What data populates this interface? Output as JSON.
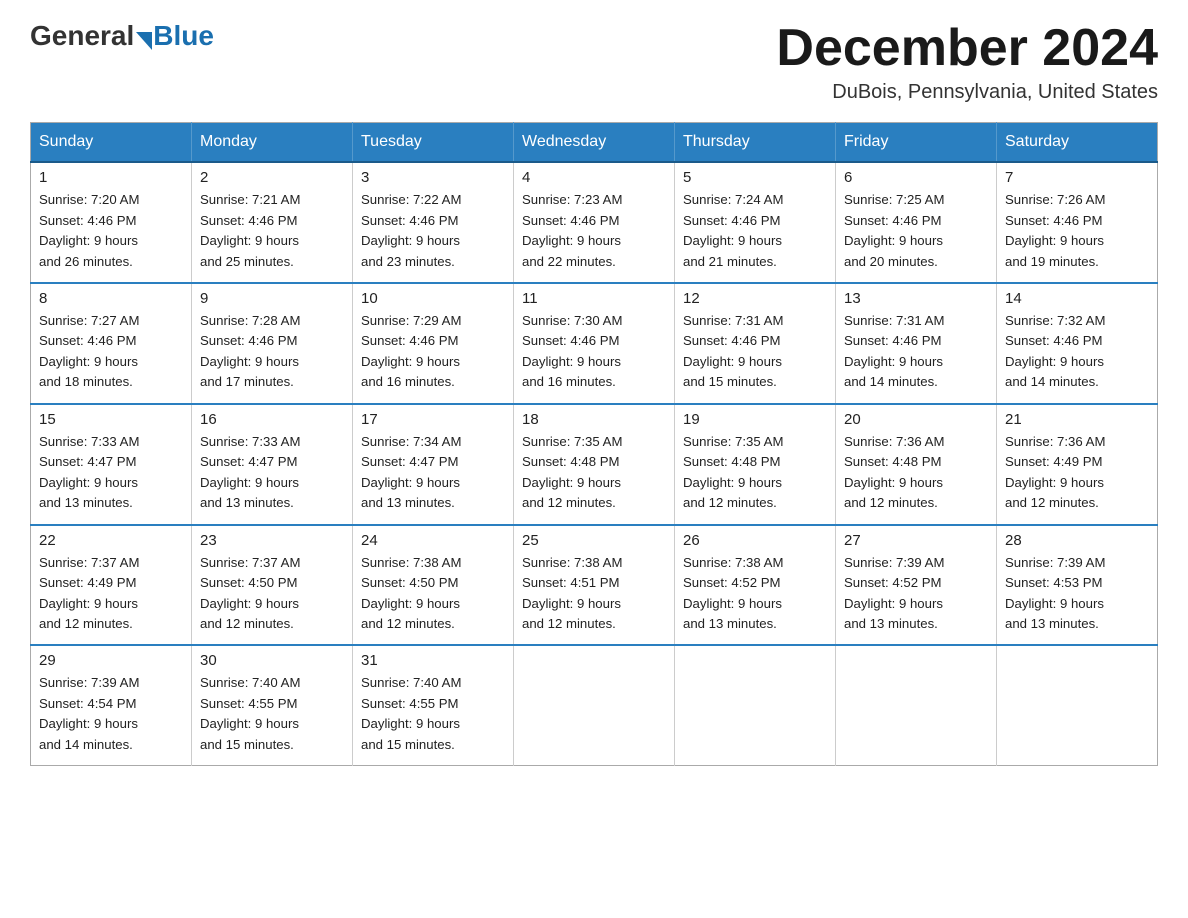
{
  "logo": {
    "general": "General",
    "blue": "Blue"
  },
  "title": "December 2024",
  "location": "DuBois, Pennsylvania, United States",
  "days_of_week": [
    "Sunday",
    "Monday",
    "Tuesday",
    "Wednesday",
    "Thursday",
    "Friday",
    "Saturday"
  ],
  "weeks": [
    [
      {
        "day": "1",
        "sunrise": "7:20 AM",
        "sunset": "4:46 PM",
        "daylight": "9 hours and 26 minutes."
      },
      {
        "day": "2",
        "sunrise": "7:21 AM",
        "sunset": "4:46 PM",
        "daylight": "9 hours and 25 minutes."
      },
      {
        "day": "3",
        "sunrise": "7:22 AM",
        "sunset": "4:46 PM",
        "daylight": "9 hours and 23 minutes."
      },
      {
        "day": "4",
        "sunrise": "7:23 AM",
        "sunset": "4:46 PM",
        "daylight": "9 hours and 22 minutes."
      },
      {
        "day": "5",
        "sunrise": "7:24 AM",
        "sunset": "4:46 PM",
        "daylight": "9 hours and 21 minutes."
      },
      {
        "day": "6",
        "sunrise": "7:25 AM",
        "sunset": "4:46 PM",
        "daylight": "9 hours and 20 minutes."
      },
      {
        "day": "7",
        "sunrise": "7:26 AM",
        "sunset": "4:46 PM",
        "daylight": "9 hours and 19 minutes."
      }
    ],
    [
      {
        "day": "8",
        "sunrise": "7:27 AM",
        "sunset": "4:46 PM",
        "daylight": "9 hours and 18 minutes."
      },
      {
        "day": "9",
        "sunrise": "7:28 AM",
        "sunset": "4:46 PM",
        "daylight": "9 hours and 17 minutes."
      },
      {
        "day": "10",
        "sunrise": "7:29 AM",
        "sunset": "4:46 PM",
        "daylight": "9 hours and 16 minutes."
      },
      {
        "day": "11",
        "sunrise": "7:30 AM",
        "sunset": "4:46 PM",
        "daylight": "9 hours and 16 minutes."
      },
      {
        "day": "12",
        "sunrise": "7:31 AM",
        "sunset": "4:46 PM",
        "daylight": "9 hours and 15 minutes."
      },
      {
        "day": "13",
        "sunrise": "7:31 AM",
        "sunset": "4:46 PM",
        "daylight": "9 hours and 14 minutes."
      },
      {
        "day": "14",
        "sunrise": "7:32 AM",
        "sunset": "4:46 PM",
        "daylight": "9 hours and 14 minutes."
      }
    ],
    [
      {
        "day": "15",
        "sunrise": "7:33 AM",
        "sunset": "4:47 PM",
        "daylight": "9 hours and 13 minutes."
      },
      {
        "day": "16",
        "sunrise": "7:33 AM",
        "sunset": "4:47 PM",
        "daylight": "9 hours and 13 minutes."
      },
      {
        "day": "17",
        "sunrise": "7:34 AM",
        "sunset": "4:47 PM",
        "daylight": "9 hours and 13 minutes."
      },
      {
        "day": "18",
        "sunrise": "7:35 AM",
        "sunset": "4:48 PM",
        "daylight": "9 hours and 12 minutes."
      },
      {
        "day": "19",
        "sunrise": "7:35 AM",
        "sunset": "4:48 PM",
        "daylight": "9 hours and 12 minutes."
      },
      {
        "day": "20",
        "sunrise": "7:36 AM",
        "sunset": "4:48 PM",
        "daylight": "9 hours and 12 minutes."
      },
      {
        "day": "21",
        "sunrise": "7:36 AM",
        "sunset": "4:49 PM",
        "daylight": "9 hours and 12 minutes."
      }
    ],
    [
      {
        "day": "22",
        "sunrise": "7:37 AM",
        "sunset": "4:49 PM",
        "daylight": "9 hours and 12 minutes."
      },
      {
        "day": "23",
        "sunrise": "7:37 AM",
        "sunset": "4:50 PM",
        "daylight": "9 hours and 12 minutes."
      },
      {
        "day": "24",
        "sunrise": "7:38 AM",
        "sunset": "4:50 PM",
        "daylight": "9 hours and 12 minutes."
      },
      {
        "day": "25",
        "sunrise": "7:38 AM",
        "sunset": "4:51 PM",
        "daylight": "9 hours and 12 minutes."
      },
      {
        "day": "26",
        "sunrise": "7:38 AM",
        "sunset": "4:52 PM",
        "daylight": "9 hours and 13 minutes."
      },
      {
        "day": "27",
        "sunrise": "7:39 AM",
        "sunset": "4:52 PM",
        "daylight": "9 hours and 13 minutes."
      },
      {
        "day": "28",
        "sunrise": "7:39 AM",
        "sunset": "4:53 PM",
        "daylight": "9 hours and 13 minutes."
      }
    ],
    [
      {
        "day": "29",
        "sunrise": "7:39 AM",
        "sunset": "4:54 PM",
        "daylight": "9 hours and 14 minutes."
      },
      {
        "day": "30",
        "sunrise": "7:40 AM",
        "sunset": "4:55 PM",
        "daylight": "9 hours and 15 minutes."
      },
      {
        "day": "31",
        "sunrise": "7:40 AM",
        "sunset": "4:55 PM",
        "daylight": "9 hours and 15 minutes."
      },
      null,
      null,
      null,
      null
    ]
  ],
  "labels": {
    "sunrise": "Sunrise:",
    "sunset": "Sunset:",
    "daylight": "Daylight: 9 hours"
  }
}
